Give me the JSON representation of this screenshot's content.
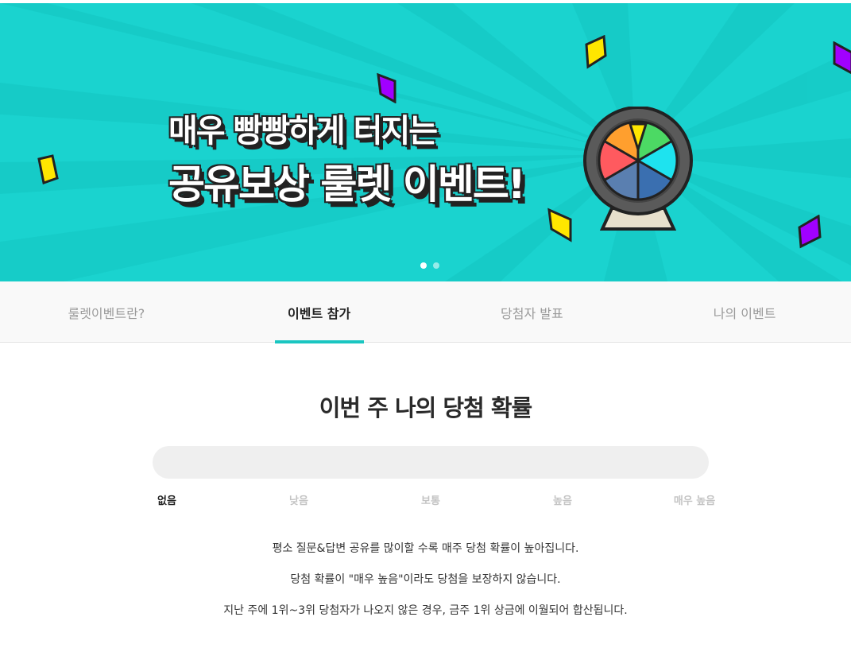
{
  "banner": {
    "headline_line1": "매우 빵빵하게 터지는",
    "headline_line2": "공유보상 룰렛 이벤트!",
    "slide_count": 2,
    "active_slide": 1,
    "colors": {
      "background": "#1ad3cf",
      "confetti_yellow": "#ffe600",
      "confetti_purple": "#a100ff"
    }
  },
  "tabs": [
    {
      "label": "룰렛이벤트란?",
      "active": false
    },
    {
      "label": "이벤트 참가",
      "active": true
    },
    {
      "label": "당첨자 발표",
      "active": false
    },
    {
      "label": "나의 이벤트",
      "active": false
    }
  ],
  "probability": {
    "title": "이번 주 나의 당첨 확률",
    "level_fraction": 0,
    "levels": [
      "없음",
      "낮음",
      "보통",
      "높음",
      "매우 높음"
    ],
    "current_level_index": 0
  },
  "notes": [
    "평소 질문&답변 공유를 많이할 수록 매주 당첨 확률이 높아집니다.",
    "당첨 확률이 \"매우 높음\"이라도 당첨을 보장하지 않습니다.",
    "지난 주에 1위~3위 당첨자가 나오지 않은 경우, 금주 1위 상금에 이월되어 합산됩니다."
  ],
  "accent_color": "#1ac6c1"
}
